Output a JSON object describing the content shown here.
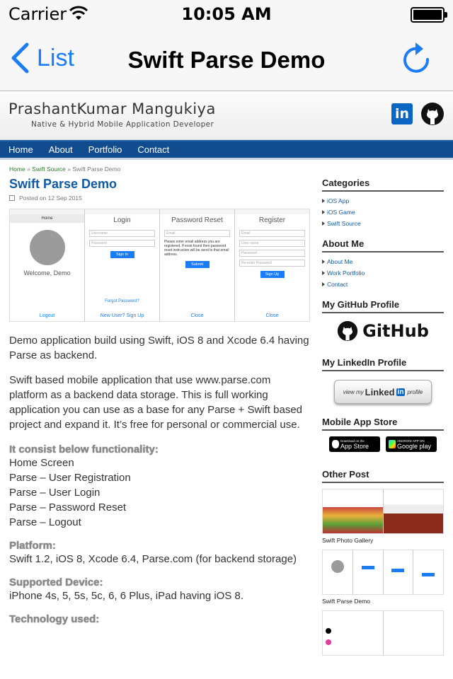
{
  "status_bar": {
    "carrier": "Carrier",
    "time": "10:05 AM"
  },
  "nav_bar": {
    "back_label": "List",
    "title": "Swift Parse Demo"
  },
  "site": {
    "author_name": "PrashantKumar Mangukiya",
    "tagline": "Native & Hybrid Mobile Application Developer",
    "linkedin_glyph": "in",
    "menu": [
      "Home",
      "About",
      "Portfolio",
      "Contact"
    ]
  },
  "breadcrumb": {
    "home": "Home",
    "sep": "»",
    "section": "Swift Source",
    "current": "Swift Parse Demo"
  },
  "post": {
    "title": "Swift Parse Demo",
    "date": "Posted on 12 Sep 2015",
    "screens": {
      "welcome": {
        "header": "Home",
        "text": "Welcome, Demo",
        "bottom": "Logout"
      },
      "login": {
        "header": "Login",
        "f1": "Username",
        "f2": "Password",
        "button": "Sign In",
        "link1": "Forgot Password?",
        "link2": "New User? Sign Up"
      },
      "reset": {
        "header": "Password Reset",
        "f1": "Email",
        "note": "Please enter email address you are registered. If exist found then password reset instruction will be send to that email address.",
        "button": "Submit",
        "bottom": "Close"
      },
      "register": {
        "header": "Register",
        "f1": "Email",
        "f2": "User name",
        "f3": "Password",
        "f4": "Re-enter Password",
        "button": "Sign Up",
        "bottom": "Close"
      }
    },
    "intro": "Demo application build using Swift, iOS 8 and Xcode 6.4 having Parse as backend.",
    "description": "Swift based mobile application that use www.parse.com platform as a backend data storage. This is full working application you can use as a base for any Parse + Swift based project and expand it. It’s free for personal or commercial use.",
    "functionality_heading": "It consist below functionality:",
    "functionality": [
      "Home Screen",
      "Parse – User Registration",
      "Parse – User Login",
      "Parse – Password Reset",
      "Parse – Logout"
    ],
    "platform_heading": "Platform:",
    "platform": "Swift 1.2, iOS 8, Xcode 6.4, Parse.com (for backend storage)",
    "devices_heading": "Supported Device:",
    "devices": "iPhone 4s, 5, 5s, 5c, 6, 6 Plus, iPad having iOS 8.",
    "technology_heading": "Technology used:"
  },
  "sidebar": {
    "categories_title": "Categories",
    "categories": [
      "iOS App",
      "iOS Game",
      "Swift Source"
    ],
    "about_title": "About Me",
    "about": [
      "About Me",
      "Work Portfolio",
      "Contact"
    ],
    "github_title": "My GitHub Profile",
    "github_text": "GitHub",
    "linkedin_title": "My LinkedIn Profile",
    "linkedin_badge": {
      "pre": "view my",
      "brand": "Linked",
      "in": "in",
      "post": "profile"
    },
    "store_title": "Mobile App Store",
    "app_store": {
      "small": "Download on the",
      "big": "App Store"
    },
    "google_play": {
      "small": "ANDROID APP ON",
      "big": "Google play"
    },
    "other_title": "Other Post",
    "other_posts": [
      "Swift Photo Gallery",
      "Swift Parse Demo"
    ]
  },
  "colors": {
    "ios_blue": "#1a7cf6",
    "menu_bar": "#114c8f",
    "link_blue": "#0d5aa7"
  }
}
